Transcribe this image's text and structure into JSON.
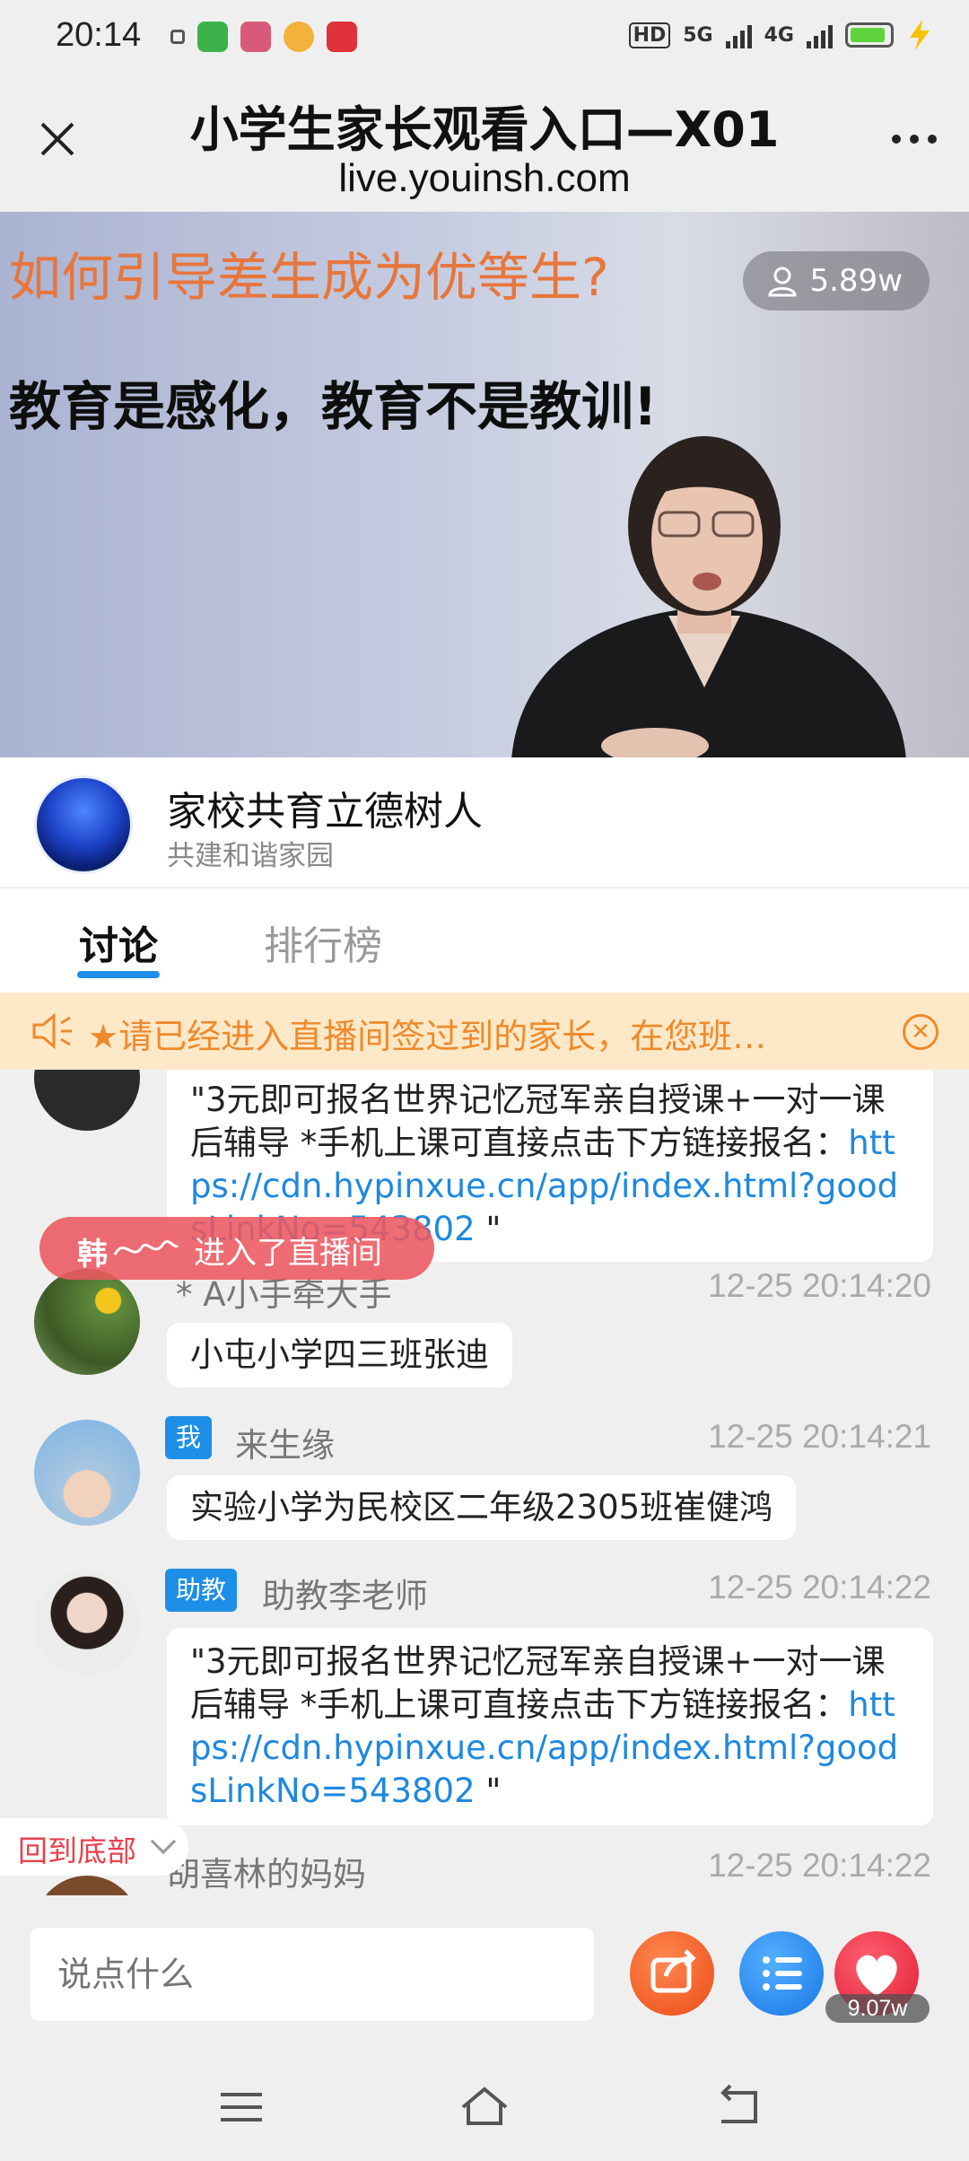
{
  "status_bar": {
    "time": "20:14",
    "hd_label": "HD",
    "net1": "5G",
    "net2": "4G"
  },
  "header": {
    "title": "小学生家长观看入口—X01",
    "url": "live.youinsh.com"
  },
  "video": {
    "headline": "如何引导差生成为优等生?",
    "subline": "教育是感化，教育不是教训!",
    "viewers": "5.89w"
  },
  "host": {
    "name": "家校共育立德树人",
    "subtitle": "共建和谐家园"
  },
  "tabs": [
    {
      "label": "讨论",
      "active": true
    },
    {
      "label": "排行榜",
      "active": false
    }
  ],
  "notice": {
    "text": "★请已经进入直播间签过到的家长，在您班…"
  },
  "chat": {
    "messages": [
      {
        "text_prefix": "\"3元即可报名世界记忆冠军亲自授课+一对一课后辅导 *手机上课可直接点击下方链接报名：",
        "link": "https://cdn.hypinxue.cn/app/index.html?goodsLinkNo=543802",
        "text_suffix": " \""
      },
      {
        "user": "* A小手牵大手",
        "time": "12-25 20:14:20",
        "text": "小屯小学四三班张迪"
      },
      {
        "badge": "我",
        "user": "来生缘",
        "time": "12-25 20:14:21",
        "text": "实验小学为民校区二年级2305班崔健鸿"
      },
      {
        "badge": "助教",
        "user": "助教李老师",
        "time": "12-25 20:14:22",
        "text_prefix": "\"3元即可报名世界记忆冠军亲自授课+一对一课后辅导 *手机上课可直接点击下方链接报名：",
        "link": "https://cdn.hypinxue.cn/app/index.html?goodsLinkNo=543802",
        "text_suffix": " \""
      },
      {
        "user": "胡喜林的妈妈",
        "time": "12-25 20:14:22"
      }
    ]
  },
  "join_toast": {
    "name": "韩",
    "text": "进入了直播间"
  },
  "scroll_bottom": {
    "label": "回到底部"
  },
  "input": {
    "placeholder": "说点什么"
  },
  "likes": "9.07w",
  "colors": {
    "accent_blue": "#1e8fe8",
    "notice_orange": "#ee8a2c",
    "like_red": "#e11c34"
  }
}
